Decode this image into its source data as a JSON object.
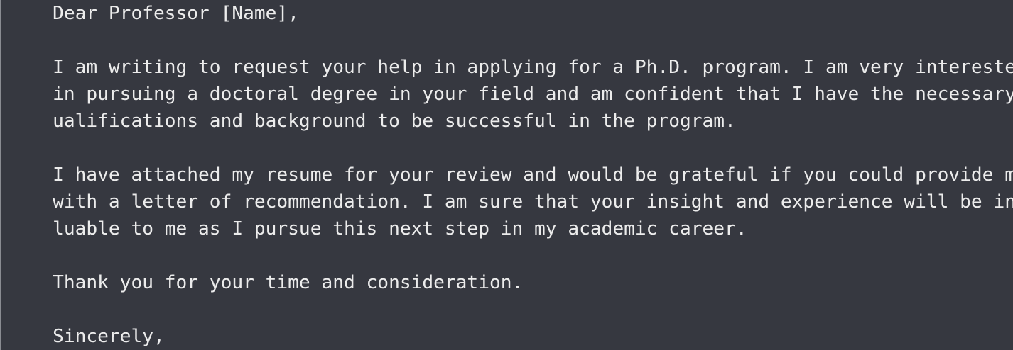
{
  "editor": {
    "lines": [
      "Dear Professor [Name],",
      "I am writing to request your help in applying for a Ph.D. program. I am very interested",
      "in pursuing a doctoral degree in your field and am confident that I have the necessary q",
      "ualifications and background to be successful in the program.",
      "I have attached my resume for your review and would be grateful if you could provide me",
      "with a letter of recommendation. I am sure that your insight and experience will be inva",
      "luable to me as I pursue this next step in my academic career.",
      "Thank you for your time and consideration.",
      "Sincerely,"
    ]
  },
  "colors": {
    "background": "#363840",
    "text": "#ececec",
    "edge": "#8a8c92"
  }
}
